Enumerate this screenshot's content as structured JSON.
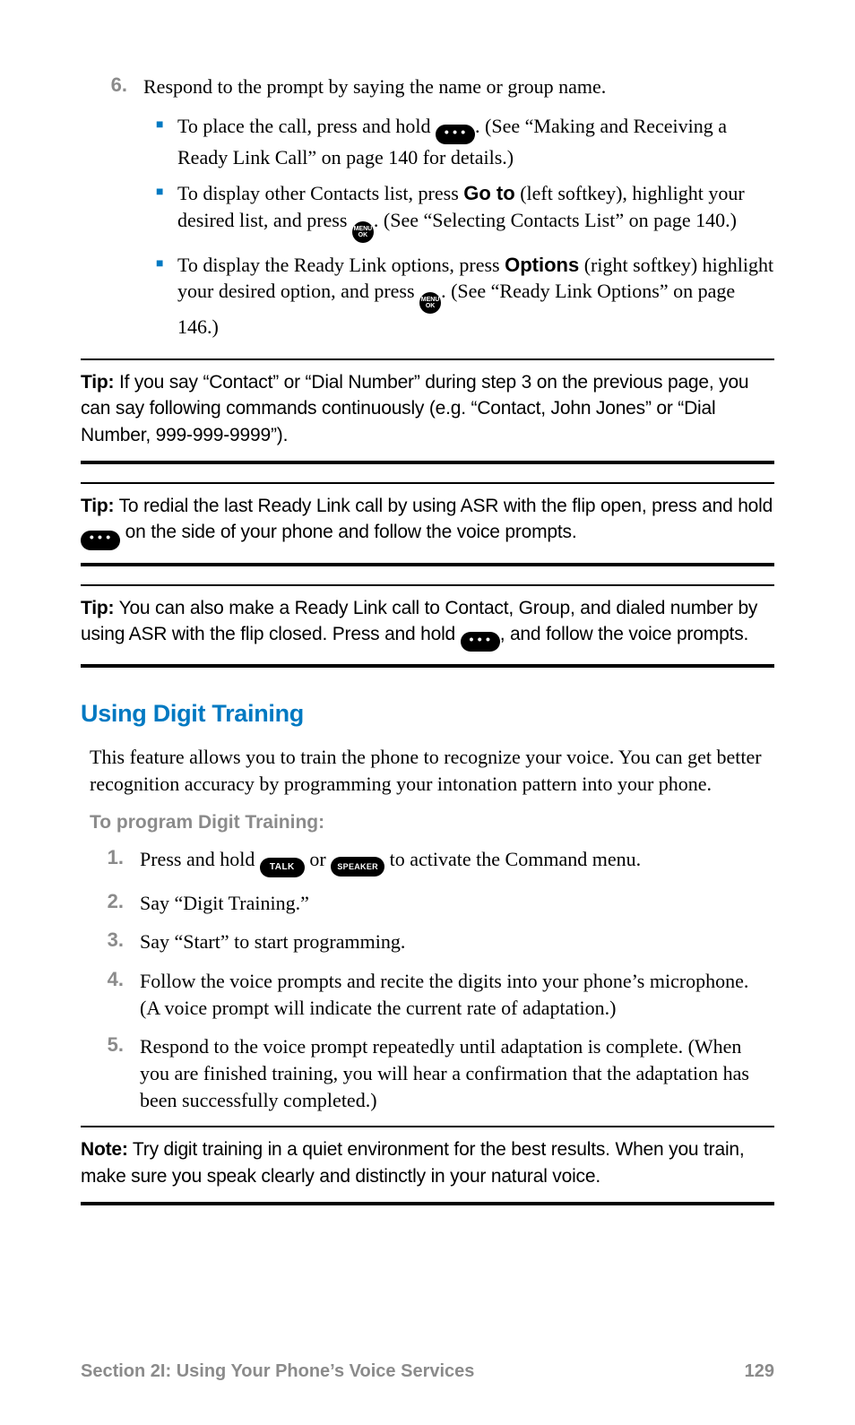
{
  "step6": {
    "num": "6.",
    "text": "Respond to the prompt by saying the name or group name.",
    "bullets": [
      {
        "pre": "To place the call, press and hold ",
        "key": "dots",
        "post": ". (See “Making and Receiving a Ready Link Call” on page 140 for details.)"
      },
      {
        "pre": "To display other Contacts list, press ",
        "bold": "Go to",
        "mid": " (left softkey), highlight your desired list, and press ",
        "key": "menu",
        "post": ". (See “Selecting Contacts List” on page 140.)"
      },
      {
        "pre": "To display the Ready Link options, press ",
        "bold": "Options",
        "mid": " (right softkey) highlight your desired option, and press ",
        "key": "menu",
        "post": ". (See “Ready Link Options” on page 146.)"
      }
    ]
  },
  "tips": [
    {
      "label": "Tip:",
      "pre": " If you say “Contact” or “Dial Number” during step 3 on the previous page, you can say following commands continuously (e.g. “Contact, John Jones” or “Dial Number, 999-999-9999”)."
    },
    {
      "label": "Tip:",
      "pre": " To redial the last Ready Link call by using ASR with the flip open, press and hold ",
      "key": "dots",
      "post": " on the side of your phone and follow the voice prompts."
    },
    {
      "label": "Tip:",
      "pre": " You can also make a Ready Link call to Contact, Group, and dialed number by using ASR with the flip closed. Press and hold ",
      "key": "dots",
      "post": ", and follow the voice prompts."
    }
  ],
  "heading": "Using Digit Training",
  "intro": "This feature allows you to train the phone to recognize your voice. You can get better recognition accuracy by programming your intonation pattern into your phone.",
  "subhead": "To program Digit Training:",
  "steps": [
    {
      "num": "1.",
      "pre": "Press and hold ",
      "key1": "talk",
      "mid": " or ",
      "key2": "speaker",
      "post": " to activate the Command menu."
    },
    {
      "num": "2.",
      "text": "Say “Digit Training.”"
    },
    {
      "num": "3.",
      "text": "Say “Start” to start programming."
    },
    {
      "num": "4.",
      "text": "Follow the voice prompts and recite the digits into your phone’s microphone. (A voice prompt will indicate the current rate of adaptation.)"
    },
    {
      "num": "5.",
      "text": "Respond to the voice prompt repeatedly until adaptation is complete. (When you are finished training, you will hear a confirmation that the adaptation has been successfully completed.)"
    }
  ],
  "note": {
    "label": "Note:",
    "text": " Try digit training in a quiet environment for the best results. When you train, make sure you speak clearly and distinctly in your natural voice."
  },
  "footer": {
    "section": "Section 2I: Using Your Phone’s Voice Services",
    "page": "129"
  },
  "keys": {
    "dots": "• • •",
    "menu_top": "MENU",
    "menu_bot": "OK",
    "talk": "TALK",
    "speaker": "SPEAKER"
  }
}
